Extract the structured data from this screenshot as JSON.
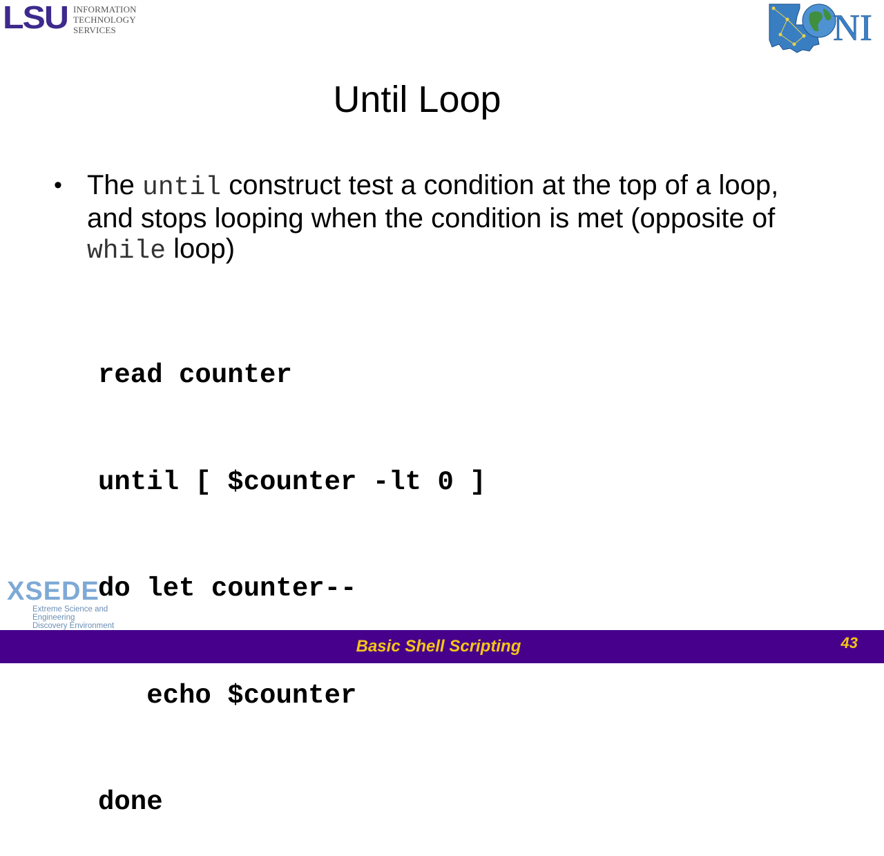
{
  "header": {
    "lsu_logo_text": "LSU",
    "lsu_sub_lines": [
      "INFORMATION",
      "TECHNOLOGY",
      "SERVICES"
    ],
    "loni_logo_text": "NI"
  },
  "slide": {
    "title": "Until Loop",
    "bullet": {
      "part1": "The ",
      "code1": "until",
      "part2": " construct test a condition at the top of a loop, and stops looping when the condition is met (opposite of ",
      "code2": "while",
      "part3": " loop)"
    },
    "code_lines": [
      "read counter",
      "until [ $counter -lt 0 ]",
      "do let counter--",
      "   echo $counter",
      "done"
    ]
  },
  "xsede": {
    "word": "XSEDE",
    "tagline_lines": [
      "Extreme Science and Engineering",
      "Discovery Environment"
    ]
  },
  "footer": {
    "title": "Basic Shell Scripting",
    "page_number": "43"
  },
  "colors": {
    "footer_bg": "#46008c",
    "footer_text": "#f5c518",
    "lsu_purple": "#3d2a8c"
  }
}
